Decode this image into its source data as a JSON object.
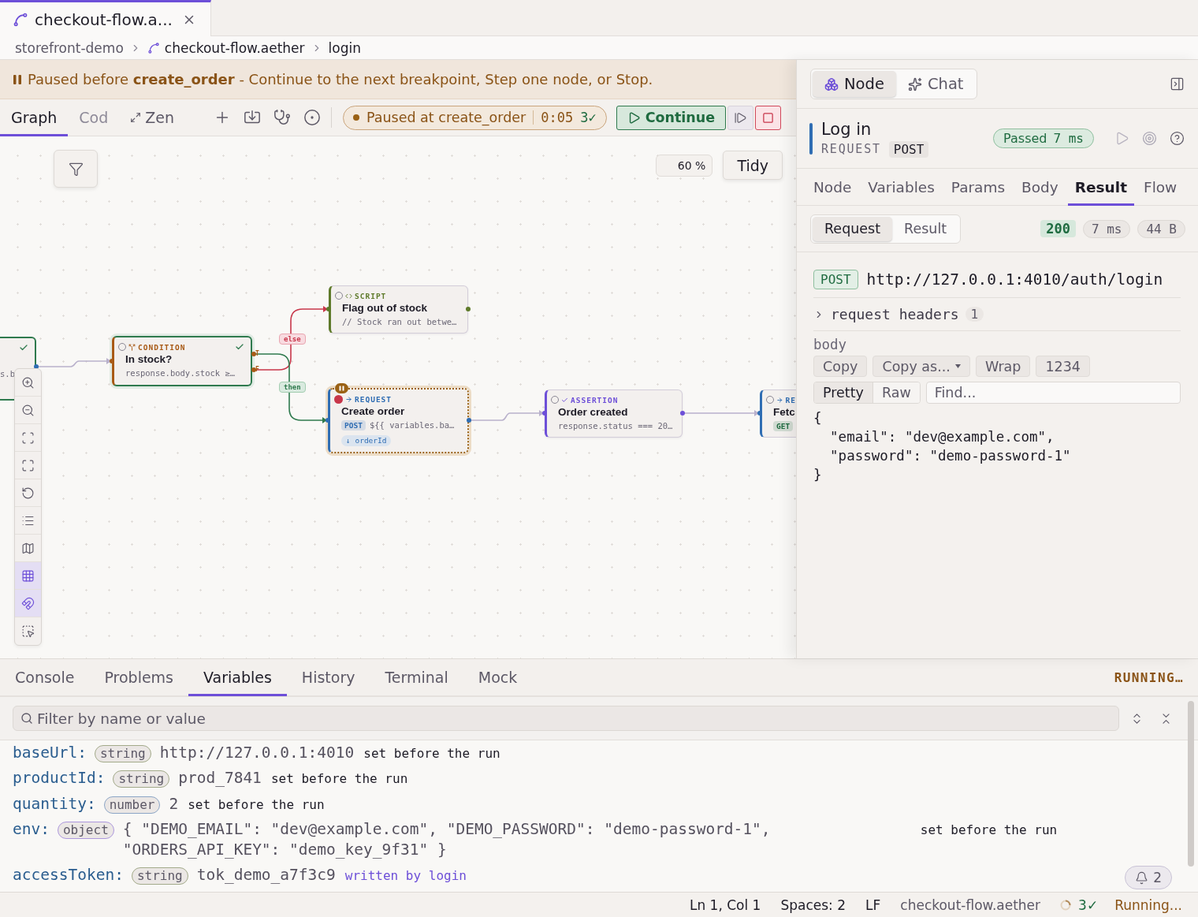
{
  "editor_tabs": [
    {
      "label": "checkout-flow.a...",
      "selected": true
    }
  ],
  "breadcrumb": [
    {
      "label": "storefront-demo",
      "kind": "folder"
    },
    {
      "label": "checkout-flow.aether",
      "kind": "flow"
    },
    {
      "label": "login",
      "kind": "node"
    }
  ],
  "banner": {
    "text": "Paused before **create_order** - Continue to the next breakpoint, Step one node, or Stop."
  },
  "view_tabs": [
    {
      "label": "Graph",
      "selected": true,
      "kind": "graph"
    },
    {
      "label": "Cod",
      "selected": false,
      "kind": "code"
    },
    {
      "label": "Zen",
      "selected": false,
      "kind": "zen"
    }
  ],
  "run_status": {
    "label": "Paused at create_order",
    "elapsed": "0:05",
    "passed": "3✓"
  },
  "continue_button": "Continue",
  "canvas": {
    "zoom": "60 %",
    "tidy_button": "Tidy",
    "tools": [
      {
        "kind": "zoom-in",
        "on": false
      },
      {
        "kind": "zoom-out",
        "on": false
      },
      {
        "kind": "fit-view",
        "on": false
      },
      {
        "kind": "fit-selection",
        "on": false
      },
      {
        "kind": "reset",
        "on": false
      },
      {
        "kind": "outline",
        "on": false
      },
      {
        "kind": "minimap",
        "on": false
      },
      {
        "kind": "grid",
        "on": true
      },
      {
        "kind": "snap",
        "on": true
      },
      {
        "kind": "select",
        "on": false
      }
    ],
    "nodes": [
      {
        "snippet": "s.b",
        "passed": true,
        "paused": false
      },
      {
        "kind": "condition",
        "type_label": "CONDITION",
        "title": "In stock?",
        "snippet": "response.body.stock ≥…",
        "passed": true,
        "paused": false,
        "breakpoint": false,
        "ports": [
          "T",
          "F"
        ]
      },
      {
        "kind": "script",
        "type_label": "SCRIPT",
        "title": "Flag out of stock",
        "snippet": "// Stock ran out betwe…",
        "passed": false,
        "paused": false,
        "breakpoint": false
      },
      {
        "kind": "request",
        "type_label": "REQUEST",
        "title": "Create order",
        "method": {
          "label": "POST",
          "color": "#2f6db3"
        },
        "snippet": "${{ variables.ba…",
        "output": "↓ orderId",
        "passed": false,
        "paused": true,
        "breakpoint": true
      },
      {
        "kind": "assertion",
        "type_label": "ASSERTION",
        "title": "Order created",
        "snippet": "response.status === 20…",
        "passed": false,
        "paused": false,
        "breakpoint": false
      },
      {
        "kind": "request",
        "type_label": "RE",
        "title": "Fetc",
        "method": {
          "label": "GET",
          "color": "#1f6b40"
        },
        "passed": false,
        "paused": false,
        "breakpoint": false
      }
    ],
    "edge_labels": [
      {
        "label": "else",
        "kind": "false"
      },
      {
        "label": "then",
        "kind": "true"
      }
    ]
  },
  "inspector": {
    "tabs": [
      {
        "label": "Node",
        "kind": "node",
        "selected": true
      },
      {
        "label": "Chat",
        "kind": "chat",
        "selected": false
      }
    ],
    "node": {
      "title": "Log in",
      "type": "REQUEST",
      "method": "POST",
      "status": "Passed",
      "duration": "7 ms"
    },
    "detail_tabs": [
      {
        "label": "Node",
        "selected": false
      },
      {
        "label": "Variables",
        "selected": false
      },
      {
        "label": "Params",
        "selected": false
      },
      {
        "label": "Body",
        "selected": false
      },
      {
        "label": "Result",
        "selected": true
      },
      {
        "label": "Flow",
        "selected": false
      }
    ],
    "view_toggle": [
      {
        "label": "Request",
        "selected": true
      },
      {
        "label": "Result",
        "selected": false
      }
    ],
    "response": {
      "status": "200",
      "time": "7 ms",
      "size": "44 B"
    },
    "request": {
      "method": "POST",
      "url": "http://127.0.0.1:4010/auth/login"
    },
    "headers": {
      "label": "request headers",
      "count": "1",
      "expanded": false
    },
    "body": {
      "label": "body",
      "actions": [
        {
          "label": "Copy",
          "kind": "plain"
        },
        {
          "label": "Copy as...",
          "kind": "menu"
        },
        {
          "label": "Wrap",
          "kind": "plain"
        },
        {
          "label": "1234",
          "kind": "plain"
        }
      ],
      "formats": [
        {
          "label": "Pretty",
          "selected": true
        },
        {
          "label": "Raw",
          "selected": false
        }
      ],
      "find": {
        "placeholder": "Find..."
      },
      "code": [
        "{",
        "  \"email\": \"dev@example.com\",",
        "  \"password\": \"demo-password-1\"",
        "}"
      ]
    }
  },
  "bottom_panel": {
    "tabs": [
      {
        "label": "Console",
        "selected": false
      },
      {
        "label": "Problems",
        "selected": false
      },
      {
        "label": "Variables",
        "selected": true
      },
      {
        "label": "History",
        "selected": false
      },
      {
        "label": "Terminal",
        "selected": false
      },
      {
        "label": "Mock",
        "selected": false
      }
    ],
    "run_state": "RUNNING…",
    "filter": {
      "placeholder": "Filter by name or value"
    },
    "variables": [
      {
        "name": "baseUrl:",
        "type": "string",
        "color": "#a3aa8a",
        "value": "http://127.0.0.1:4010",
        "note": "set before the run",
        "kind": "preset"
      },
      {
        "name": "productId:",
        "type": "string",
        "color": "#a3aa8a",
        "value": "prod_7841",
        "note": "set before the run",
        "kind": "preset"
      },
      {
        "name": "quantity:",
        "type": "number",
        "color": "#8ca6c6",
        "value": "2",
        "note": "set before the run",
        "kind": "preset"
      },
      {
        "name": "env:",
        "type": "object",
        "color": "#ad98dd",
        "value": "{ \"DEMO_EMAIL\": \"dev@example.com\", \"DEMO_PASSWORD\": \"demo-password-1\", \"ORDERS_API_KEY\": \"demo_key_9f31\" }",
        "note": "set before the run",
        "kind": "preset"
      },
      {
        "name": "accessToken:",
        "type": "string",
        "color": "#a3aa8a",
        "value": "tok_demo_a7f3c9",
        "note": "written by login",
        "kind": "written"
      }
    ],
    "notifications": "2"
  },
  "status_bar": {
    "items": [
      {
        "label": "Ln 1, Col 1",
        "kind": "plain"
      },
      {
        "label": "Spaces: 2",
        "kind": "plain"
      },
      {
        "label": "LF",
        "kind": "plain"
      },
      {
        "label": "checkout-flow.aether",
        "kind": "muted"
      }
    ],
    "passed": "3✓",
    "state": "Running..."
  }
}
